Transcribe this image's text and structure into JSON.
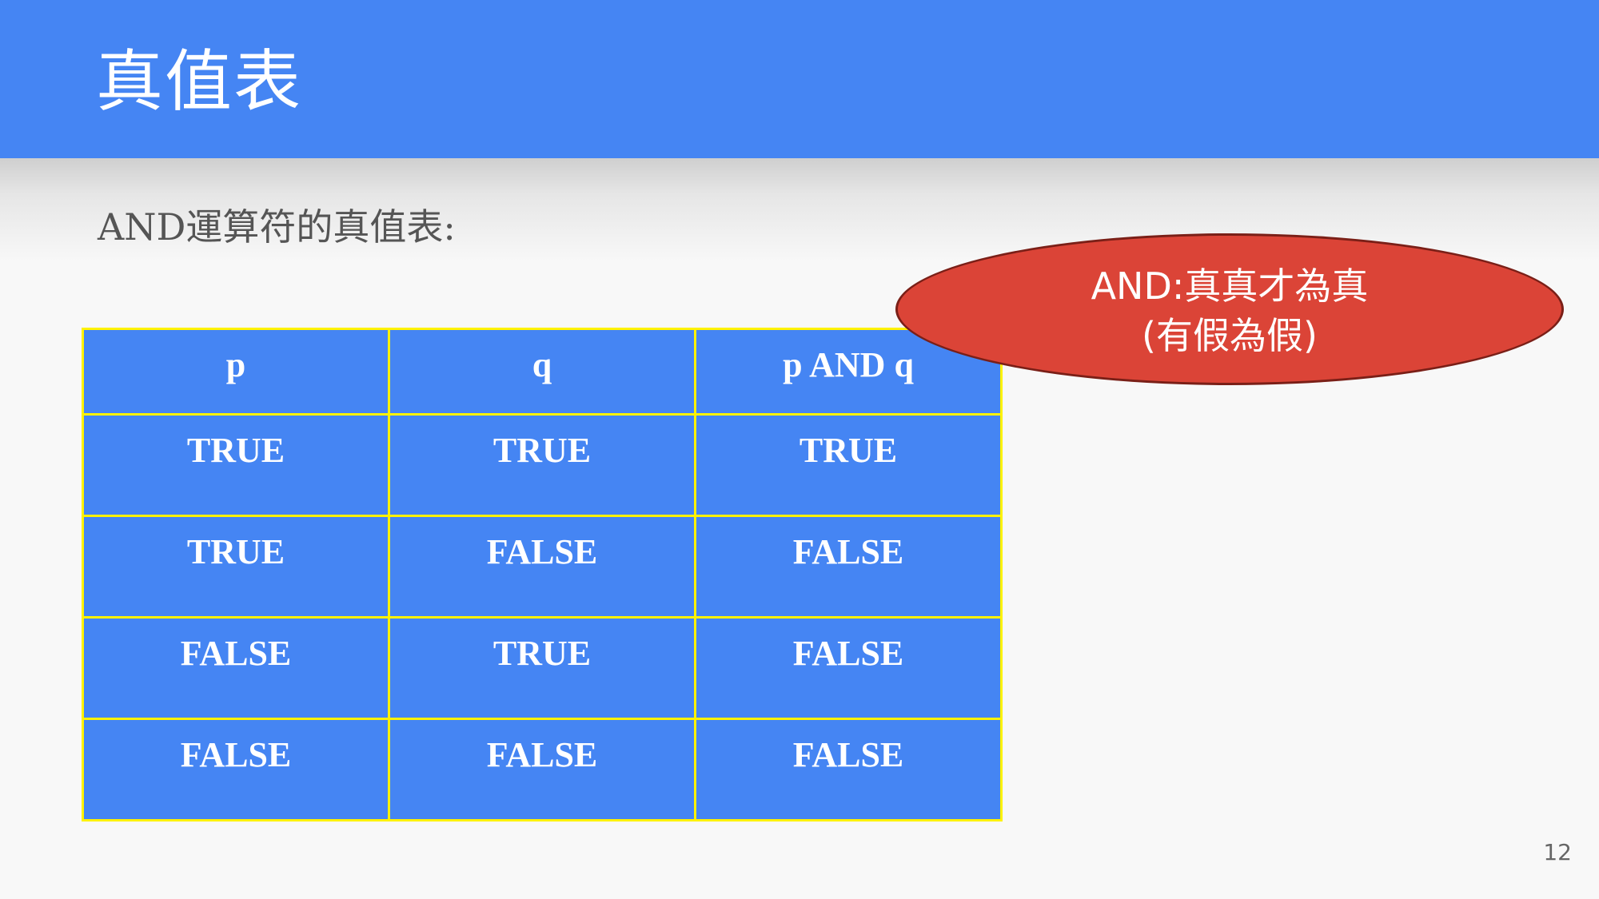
{
  "slide": {
    "title": "真值表",
    "subtitle": "AND運算符的真值表:",
    "page_number": "12"
  },
  "table": {
    "headers": [
      "p",
      "q",
      "p AND q"
    ],
    "rows": [
      [
        "TRUE",
        "TRUE",
        "TRUE"
      ],
      [
        "TRUE",
        "FALSE",
        "FALSE"
      ],
      [
        "FALSE",
        "TRUE",
        "FALSE"
      ],
      [
        "FALSE",
        "FALSE",
        "FALSE"
      ]
    ]
  },
  "callout": {
    "line1": "AND:真真才為真",
    "line2": "(有假為假)"
  },
  "colors": {
    "header_bar": "#4585f3",
    "table_fill": "#4585f3",
    "table_border": "#fef200",
    "callout_fill": "#db4437",
    "background": "#f8f8f8"
  }
}
